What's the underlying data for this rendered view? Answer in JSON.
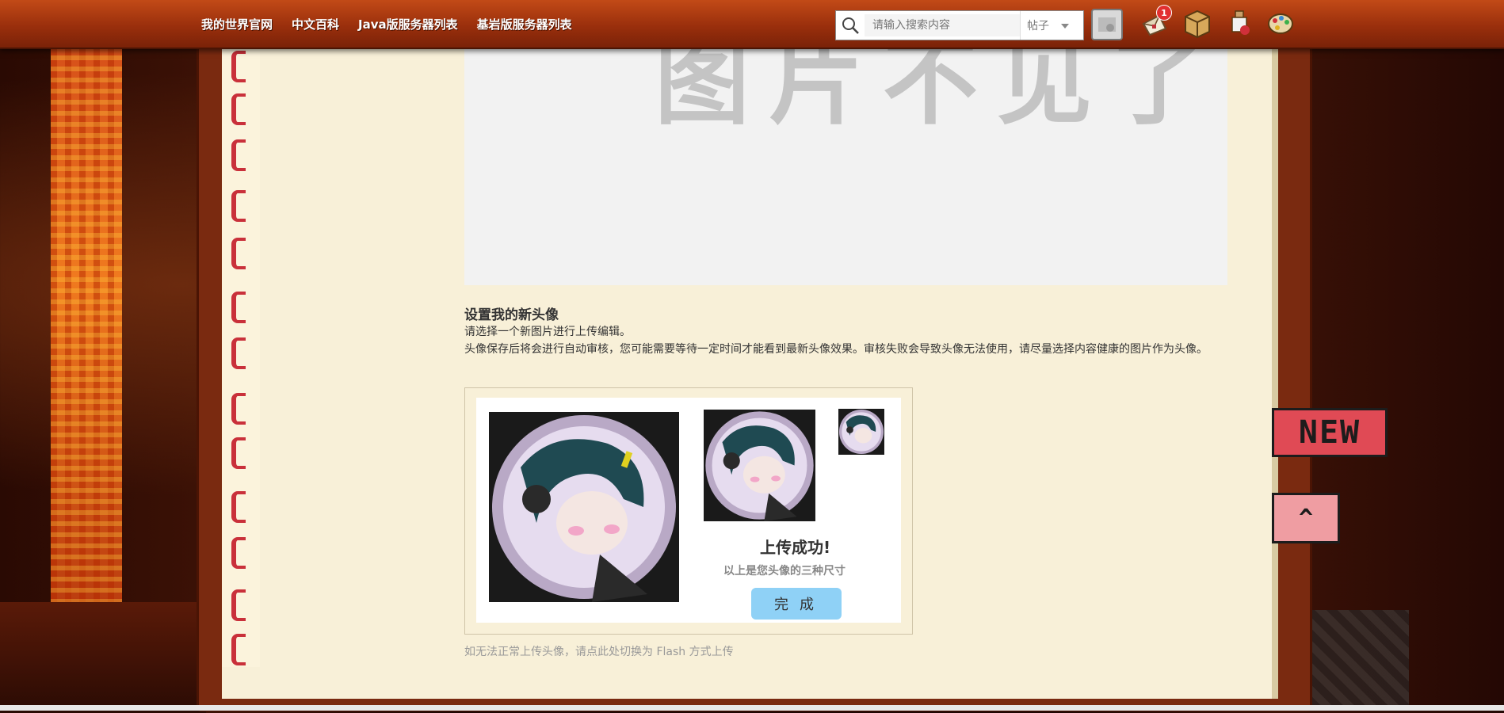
{
  "nav": {
    "items": [
      "我的世界官网",
      "中文百科",
      "Java版服务器列表",
      "基岩版服务器列表"
    ]
  },
  "search": {
    "placeholder": "请输入搜索内容",
    "scope": "帖子"
  },
  "notifications": {
    "badge": "1"
  },
  "preview": {
    "placeholder_text": "图片不见了"
  },
  "avatar_section": {
    "title": "设置我的新头像",
    "line1": "请选择一个新图片进行上传编辑。",
    "line2": "头像保存后将会进行自动审核，您可能需要等待一定时间才能看到最新头像效果。审核失败会导致头像无法使用，请尽量选择内容健康的图片作为头像。",
    "success_title": "上传成功!",
    "success_sub": "以上是您头像的三种尺寸",
    "done_button": "完成",
    "flash_link": "如无法正常上传头像，请点此处切换为 Flash 方式上传"
  },
  "side_flags": {
    "new": "NEW",
    "top": "^"
  },
  "colors": {
    "topbar": "#a8360f",
    "page": "#f8f0d8",
    "done_button": "#8fd1f6",
    "ring": "#c9303a"
  }
}
